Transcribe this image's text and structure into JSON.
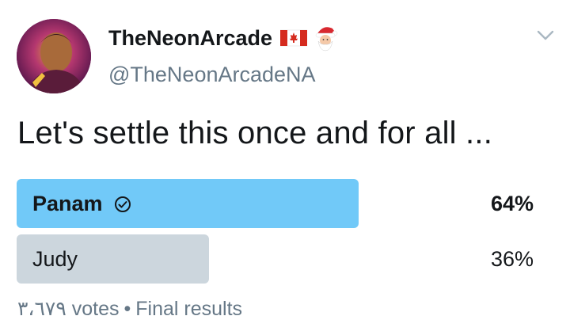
{
  "author": {
    "display_name": "TheNeonArcade",
    "handle": "@TheNeonArcadeNA",
    "flag_icon": "canada-flag-icon",
    "emoji_icon": "santa-emoji-icon"
  },
  "tweet": {
    "text": "Let's settle this once and for all ..."
  },
  "poll": {
    "options": [
      {
        "label": "Panam",
        "percent_text": "64%",
        "percent": 64,
        "winner": true
      },
      {
        "label": "Judy",
        "percent_text": "36%",
        "percent": 36,
        "winner": false
      }
    ],
    "votes_text": "٣،٦٧٩ votes",
    "separator": "•",
    "status_text": "Final results"
  },
  "colors": {
    "winner_bar": "#71c9f8",
    "loser_bar": "#ccd6dd",
    "secondary_text": "#657786"
  }
}
